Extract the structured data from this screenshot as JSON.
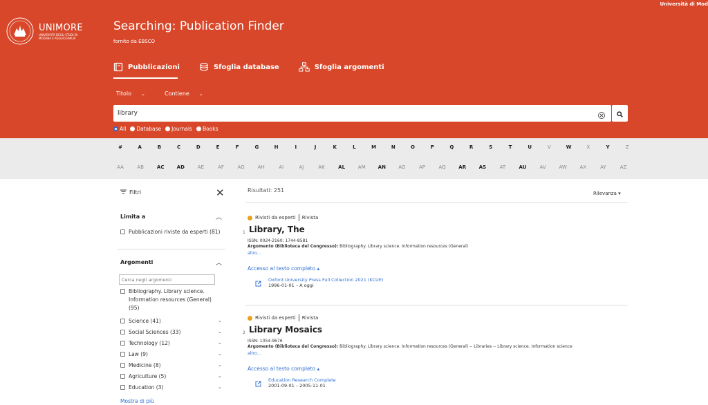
{
  "header": {
    "top_right_text": "Università di Mod",
    "brand_name": "UNIMORE",
    "brand_sub": "UNIVERSITÀ DEGLI STUDI DI MODENA E REGGIO EMILIA",
    "page_title": "Searching: Publication Finder",
    "page_subtitle": "fornito da EBSCO",
    "background_color": "#d8472a"
  },
  "tabs": [
    {
      "label": "Pubblicazioni",
      "icon": "book-icon",
      "active": true
    },
    {
      "label": "Sfoglia database",
      "icon": "database-icon",
      "active": false
    },
    {
      "label": "Sfoglia argomenti",
      "icon": "sitemap-icon",
      "active": false
    }
  ],
  "search": {
    "field_select": "Titolo",
    "match_select": "Contiene",
    "query": "library",
    "clear_icon": "clear-icon",
    "search_icon": "search-icon"
  },
  "radios": [
    {
      "label": "All",
      "selected": true
    },
    {
      "label": "Database",
      "selected": false
    },
    {
      "label": "Journals",
      "selected": false
    },
    {
      "label": "Books",
      "selected": false
    }
  ],
  "alphabet": {
    "row1": [
      {
        "t": "#",
        "b": true
      },
      {
        "t": "A",
        "b": true
      },
      {
        "t": "B",
        "b": true
      },
      {
        "t": "C",
        "b": true
      },
      {
        "t": "D",
        "b": true
      },
      {
        "t": "E",
        "b": true
      },
      {
        "t": "F",
        "b": true
      },
      {
        "t": "G",
        "b": true
      },
      {
        "t": "H",
        "b": true
      },
      {
        "t": "I",
        "b": true
      },
      {
        "t": "J",
        "b": true
      },
      {
        "t": "K",
        "b": true
      },
      {
        "t": "L",
        "b": true
      },
      {
        "t": "M",
        "b": true
      },
      {
        "t": "N",
        "b": true
      },
      {
        "t": "O",
        "b": true
      },
      {
        "t": "P",
        "b": true
      },
      {
        "t": "Q",
        "b": true
      },
      {
        "t": "R",
        "b": true
      },
      {
        "t": "S",
        "b": true
      },
      {
        "t": "T",
        "b": true
      },
      {
        "t": "U",
        "b": true
      },
      {
        "t": "V",
        "b": false
      },
      {
        "t": "W",
        "b": true
      },
      {
        "t": "X",
        "b": false
      },
      {
        "t": "Y",
        "b": true
      },
      {
        "t": "Z",
        "b": false
      }
    ],
    "row2": [
      {
        "t": "AA",
        "b": false
      },
      {
        "t": "AB",
        "b": false
      },
      {
        "t": "AC",
        "b": true
      },
      {
        "t": "AD",
        "b": true
      },
      {
        "t": "AE",
        "b": false
      },
      {
        "t": "AF",
        "b": false
      },
      {
        "t": "AG",
        "b": false
      },
      {
        "t": "AH",
        "b": false
      },
      {
        "t": "AI",
        "b": false
      },
      {
        "t": "AJ",
        "b": false
      },
      {
        "t": "AK",
        "b": false
      },
      {
        "t": "AL",
        "b": true
      },
      {
        "t": "AM",
        "b": false
      },
      {
        "t": "AN",
        "b": true
      },
      {
        "t": "AO",
        "b": false
      },
      {
        "t": "AP",
        "b": false
      },
      {
        "t": "AQ",
        "b": false
      },
      {
        "t": "AR",
        "b": true
      },
      {
        "t": "AS",
        "b": true
      },
      {
        "t": "AT",
        "b": false
      },
      {
        "t": "AU",
        "b": true
      },
      {
        "t": "AV",
        "b": false
      },
      {
        "t": "AW",
        "b": false
      },
      {
        "t": "AX",
        "b": false
      },
      {
        "t": "AY",
        "b": false
      },
      {
        "t": "AZ",
        "b": false
      }
    ]
  },
  "filters": {
    "title": "Filtri",
    "limita_title": "Limita a",
    "limita_items": [
      "Pubblicazioni riviste da esperti (81)"
    ],
    "argomenti_title": "Argomenti",
    "argomenti_placeholder": "Cerca negli argomenti",
    "argomenti_items": [
      {
        "label": "Bibliography. Library science. Information resources (General) (95)"
      },
      {
        "label": "Science (41)"
      },
      {
        "label": "Social Sciences (33)"
      },
      {
        "label": "Technology (12)"
      },
      {
        "label": "Law (9)"
      },
      {
        "label": "Medicine (8)"
      },
      {
        "label": "Agriculture (5)"
      },
      {
        "label": "Education (3)"
      }
    ],
    "mostra_label": "Mostra di più"
  },
  "results": {
    "count_label": "Risultati: 251",
    "sort_label": "Rilevanza",
    "items": [
      {
        "index": "1",
        "tag1": "Rivisti da esperti",
        "tag2": "Rivista",
        "title": "Library, The",
        "issn": "ISSN: 0024-2160; 1744-8581",
        "arg_label": "Argomento (Biblioteca del Congresso):",
        "arg_value": " Bibliography. Library science. Information resources (General)",
        "altro": "altro...",
        "accesso": "Accesso al testo completo",
        "link_name": "Oxford University Press Full Collection 2021 (KCUE)",
        "link_date": "1996-01-01 – A oggi"
      },
      {
        "index": "2",
        "tag1": "Rivisti da esperti",
        "tag2": "Rivista",
        "title": "Library Mosaics",
        "issn": "ISSN: 1054-9676",
        "arg_label": "Argomento (Biblioteca del Congresso):",
        "arg_value": " Bibliography. Library science. Information resources (General) -- Libraries -- Library science. Information science",
        "altro": "altro...",
        "accesso": "Accesso al testo completo",
        "link_name": "Education Research Complete",
        "link_date": "2001-09-01 – 2005-11-01"
      }
    ]
  }
}
